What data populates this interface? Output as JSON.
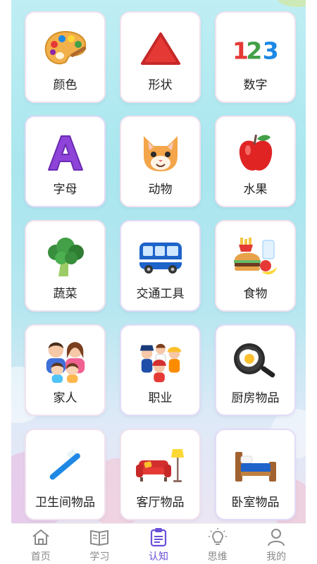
{
  "categories": [
    {
      "label": "颜色",
      "icon": "palette-icon"
    },
    {
      "label": "形状",
      "icon": "triangle-icon"
    },
    {
      "label": "数字",
      "icon": "numbers-123-icon"
    },
    {
      "label": "字母",
      "icon": "letter-a-icon"
    },
    {
      "label": "动物",
      "icon": "cat-face-icon"
    },
    {
      "label": "水果",
      "icon": "apple-icon"
    },
    {
      "label": "蔬菜",
      "icon": "broccoli-icon"
    },
    {
      "label": "交通工具",
      "icon": "bus-icon"
    },
    {
      "label": "食物",
      "icon": "burger-food-icon"
    },
    {
      "label": "家人",
      "icon": "family-icon"
    },
    {
      "label": "职业",
      "icon": "professions-icon"
    },
    {
      "label": "厨房物品",
      "icon": "frying-pan-icon"
    },
    {
      "label": "卫生间物品",
      "icon": "toothbrush-icon"
    },
    {
      "label": "客厅物品",
      "icon": "sofa-lamp-icon"
    },
    {
      "label": "卧室物品",
      "icon": "bed-icon"
    }
  ],
  "tabbar": {
    "home": {
      "label": "首页",
      "icon": "home-icon"
    },
    "study": {
      "label": "学习",
      "icon": "book-icon"
    },
    "cognition": {
      "label": "认知",
      "icon": "clipboard-icon"
    },
    "thinking": {
      "label": "思维",
      "icon": "lightbulb-icon"
    },
    "mine": {
      "label": "我的",
      "icon": "user-icon"
    },
    "active": "认知"
  },
  "colors": {
    "accent": "#6b4fd8",
    "tab_inactive": "#8a8a8a"
  }
}
